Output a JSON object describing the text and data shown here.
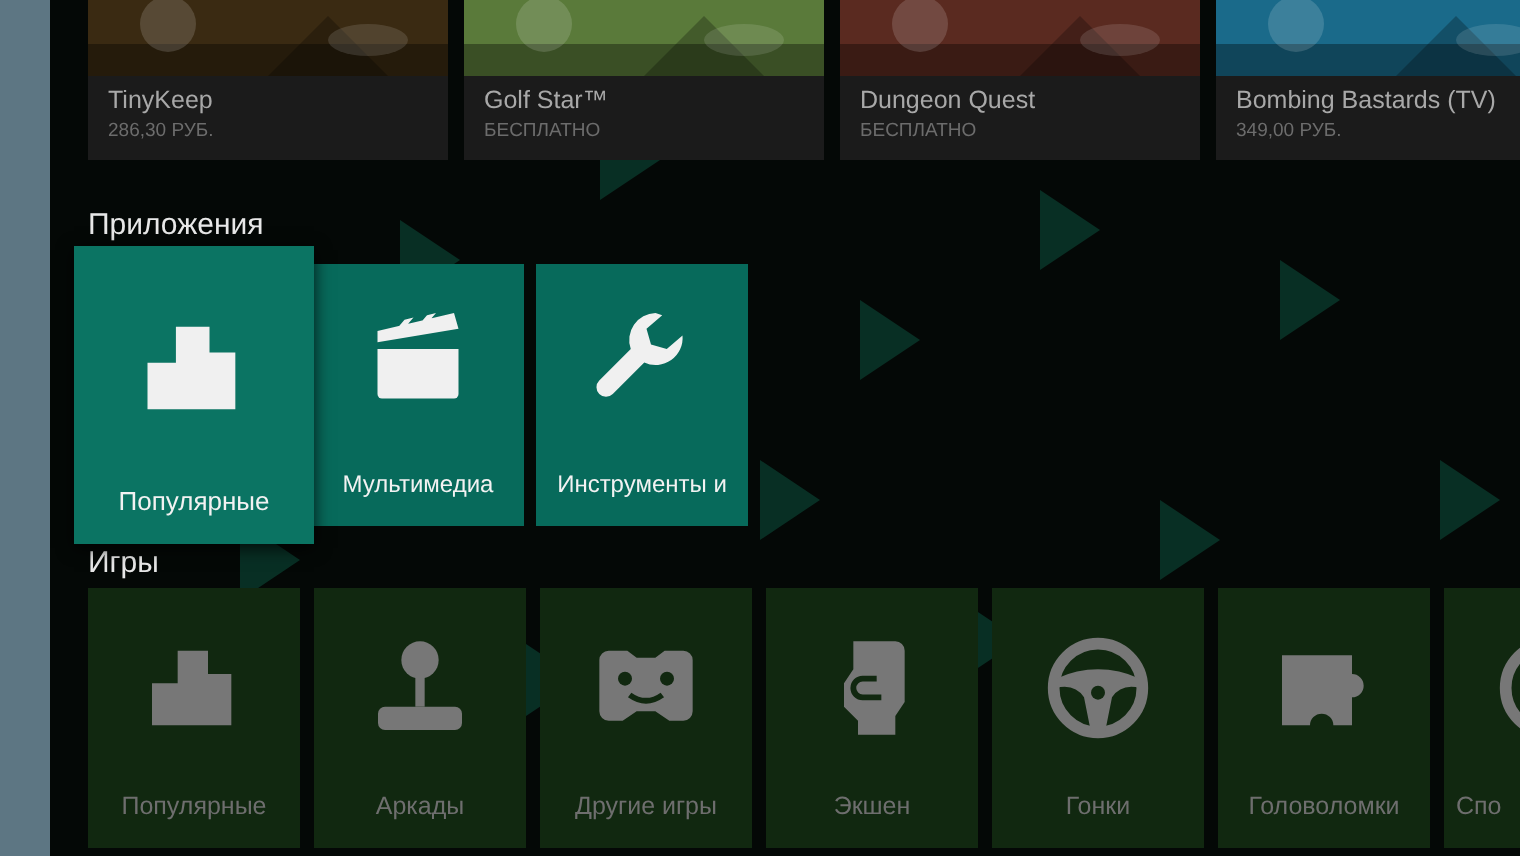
{
  "featured": [
    {
      "title": "TinyKeep",
      "price": "286,30 РУБ."
    },
    {
      "title": "Golf Star™",
      "price": "БЕСПЛАТНО"
    },
    {
      "title": "Dungeon Quest",
      "price": "БЕСПЛАТНО"
    },
    {
      "title": "Bombing Bastards (TV)",
      "price": "349,00 РУБ."
    }
  ],
  "apps": {
    "heading": "Приложения",
    "items": [
      {
        "label": "Популярные",
        "kind": "podium",
        "selected": true
      },
      {
        "label": "Мультимедиа",
        "kind": "clapper",
        "selected": false
      },
      {
        "label": "Инструменты и",
        "kind": "wrench",
        "selected": false
      }
    ]
  },
  "games": {
    "heading": "Игры",
    "items": [
      {
        "label": "Популярные",
        "kind": "podium"
      },
      {
        "label": "Аркады",
        "kind": "joystick"
      },
      {
        "label": "Другие игры",
        "kind": "gamepad"
      },
      {
        "label": "Экшен",
        "kind": "fist"
      },
      {
        "label": "Гонки",
        "kind": "wheel"
      },
      {
        "label": "Головоломки",
        "kind": "puzzle"
      },
      {
        "label": "Спо",
        "kind": "ball"
      }
    ]
  }
}
